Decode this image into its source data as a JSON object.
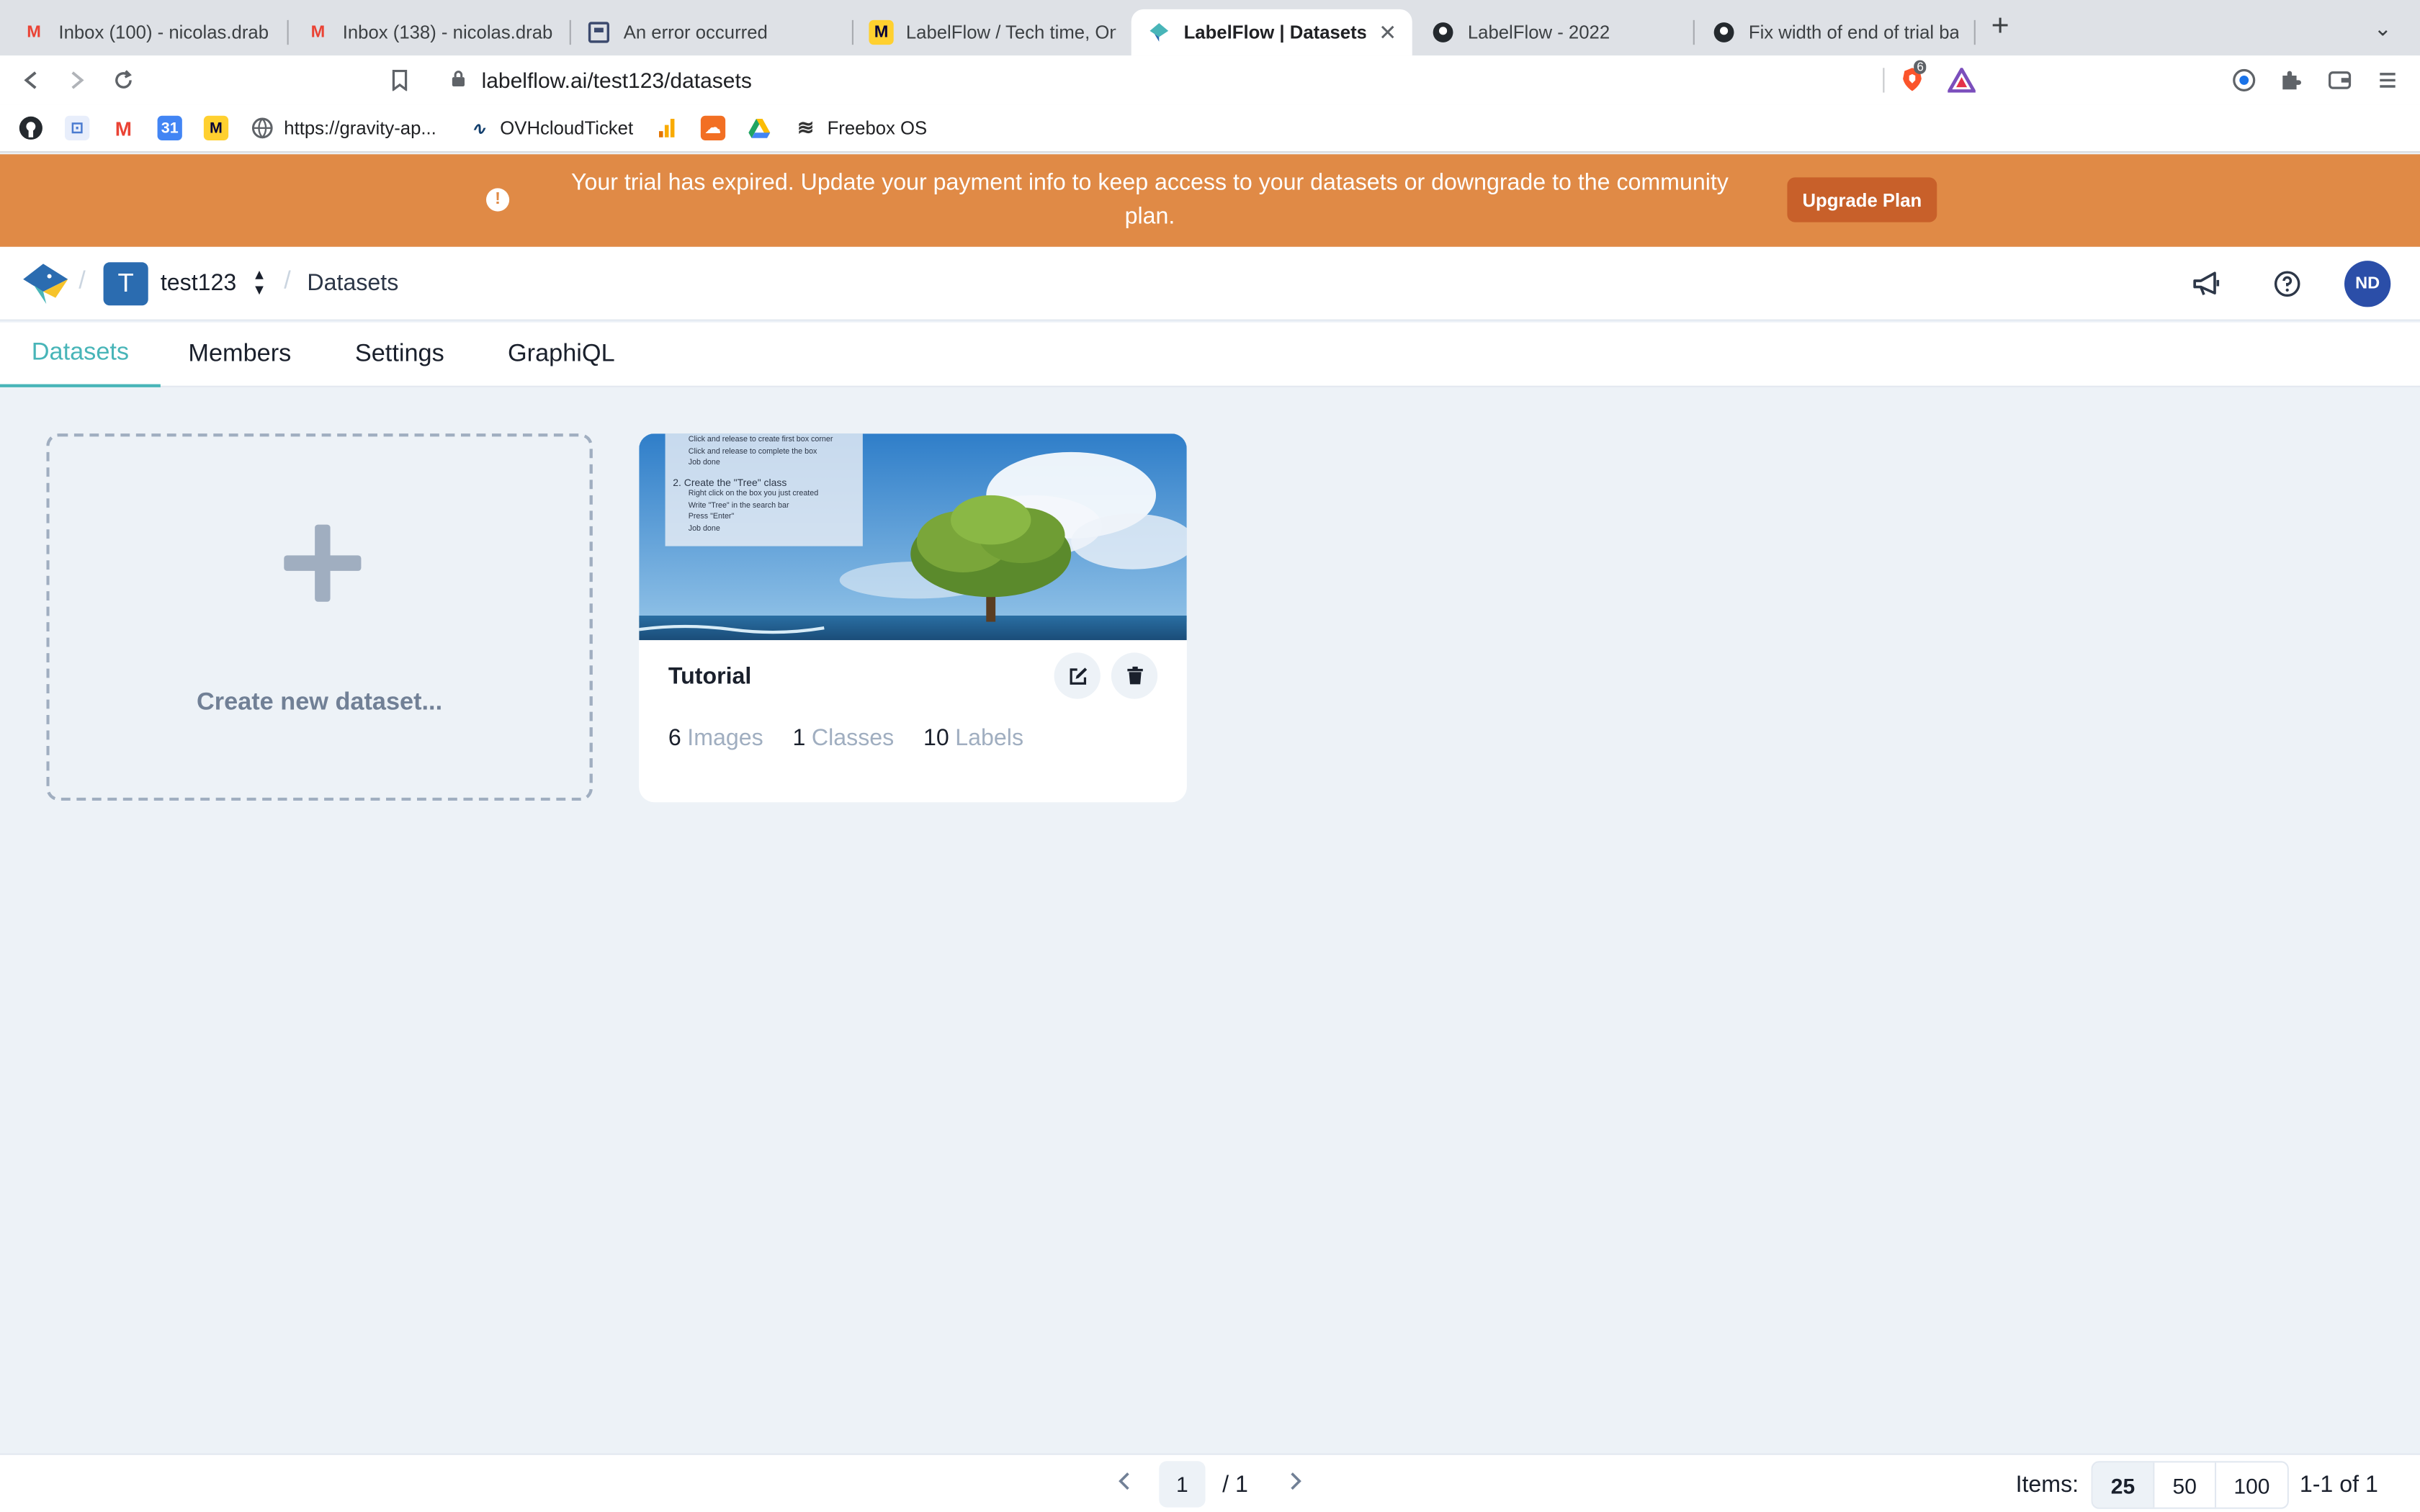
{
  "browser": {
    "tabs": [
      {
        "title": "Inbox (100) - nicolas.draber",
        "icon": "gmail-icon"
      },
      {
        "title": "Inbox (138) - nicolas.draber",
        "icon": "gmail-icon"
      },
      {
        "title": "An error occurred",
        "icon": "document-icon"
      },
      {
        "title": "LabelFlow / Tech time, Onlin",
        "icon": "miro-icon"
      },
      {
        "title": "LabelFlow | Datasets",
        "icon": "labelflow-icon",
        "active": true
      },
      {
        "title": "LabelFlow - 2022",
        "icon": "github-icon"
      },
      {
        "title": "Fix width of end of trial ban",
        "icon": "github-icon"
      }
    ],
    "address": "labelflow.ai/test123/datasets",
    "shield_count": "6",
    "bookmarks": [
      {
        "label": "",
        "icon": "github-icon",
        "color": "#24292e"
      },
      {
        "label": "",
        "icon": "meet-icon",
        "color": "#4a7bd0"
      },
      {
        "label": "",
        "icon": "gmail-icon",
        "color": "#ea4335"
      },
      {
        "label": "",
        "icon": "calendar-icon",
        "color": "#4285f4"
      },
      {
        "label": "",
        "icon": "miro-icon",
        "color": "#1c1c1c"
      },
      {
        "label": "https://gravity-ap...",
        "icon": "globe-icon",
        "color": "#5f6368"
      },
      {
        "label": "OVHcloudTicket",
        "icon": "ovh-icon",
        "color": "#123f6d"
      },
      {
        "label": "",
        "icon": "analytics-icon",
        "color": "#f9ab00"
      },
      {
        "label": "",
        "icon": "soundcloud-icon",
        "color": "#f26f23"
      },
      {
        "label": "",
        "icon": "drive-icon",
        "color": "#1fa463"
      },
      {
        "label": "Freebox OS",
        "icon": "freebox-icon",
        "color": "#333333"
      }
    ]
  },
  "banner": {
    "message": "Your trial has expired. Update your payment info to keep access to your datasets or downgrade to the community plan.",
    "button": "Upgrade Plan",
    "color": "#e08a46"
  },
  "header": {
    "workspace_initial": "T",
    "workspace_name": "test123",
    "page": "Datasets",
    "user_initials": "ND"
  },
  "nav": {
    "tabs": [
      "Datasets",
      "Members",
      "Settings",
      "GraphiQL"
    ],
    "active": "Datasets",
    "accent": "#48b5b8"
  },
  "datasets": {
    "create_label": "Create new dataset...",
    "cards": [
      {
        "name": "Tutorial",
        "thumbnail_text": [
          "Click and release to create first box corner",
          "Click and release to complete the box",
          "Job done",
          "2. Create the \"Tree\" class",
          "Right click on the box you just created",
          "Write \"Tree\" in the search bar",
          "Press \"Enter\"",
          "Job done"
        ],
        "stats": [
          {
            "count": "6",
            "unit": "Images"
          },
          {
            "count": "1",
            "unit": "Classes"
          },
          {
            "count": "10",
            "unit": "Labels"
          }
        ]
      }
    ]
  },
  "pagination": {
    "current": "1",
    "total": "/ 1",
    "items_label": "Items:",
    "per_page": [
      "25",
      "50",
      "100"
    ],
    "selected_per_page": "25",
    "range": "1-1 of 1"
  }
}
